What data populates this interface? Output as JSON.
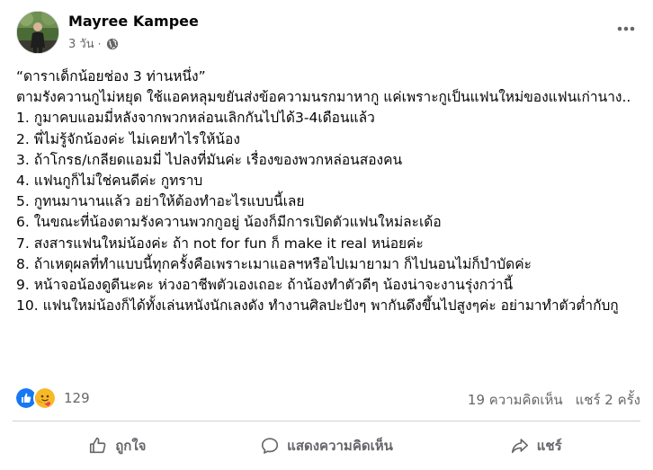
{
  "post": {
    "author": "Mayree Kampee",
    "time": "3 วัน",
    "separator": "·",
    "audience_icon": "globe-icon",
    "lines": [
      "“ดาราเด็กน้อยช่อง 3 ท่านหนึ่ง”",
      "ตามรังควานกูไม่หยุด ใช้แอคหลุมขยันส่งข้อความนรกมาหากู แค่เพราะกูเป็นแฟนใหม่ของแฟนเก่านาง..",
      "1. กูมาคบแอมมี่หลังจากพวกหล่อนเลิกกันไปได้3-4เดือนแล้ว",
      "2. พี่ไม่รู้จักน้องค่ะ ไม่เคยทำไรให้น้อง",
      "3. ถ้าโกรธ/เกลียดแอมมี่ ไปลงที่มันค่ะ เรื่องของพวกหล่อนสองคน",
      "4. แฟนกูก็ไม่ใช่คนดีค่ะ กูทราบ",
      "5. กูทนมานานแล้ว อย่าให้ต้องทำอะไรแบบนี้เลย",
      "6. ในขณะที่น้องตามรังควานพวกกูอยู่ น้องก็มีการเปิดตัวแฟนใหม่ละเด้อ",
      "7. สงสารแฟนใหม่น้องค่ะ ถ้า not for fun ก็ make it real หน่อยค่ะ",
      "8. ถ้าเหตุผลที่ทำแบบนี้ทุกครั้งคือเพราะเมาแอลฯหรือไปเมายามา ก็ไปนอนไม่ก็บำบัดค่ะ",
      "9. หน้าจอน้องดูดีนะคะ ห่วงอาชีพตัวเองเถอะ ถ้าน้องทำตัวดีๆ น้องน่าจะงานรุ่งกว่านี้",
      "10. แฟนใหม่น้องก็ได้ทั้งเล่นหนังนักเลงดัง ทำงานศิลปะปังๆ พากันดึงขึ้นไปสูงๆค่ะ อย่ามาทำตัวต่ำกับกู"
    ]
  },
  "reactions": {
    "icons": [
      "like-icon",
      "care-icon"
    ],
    "count": "129",
    "comments": "19 ความคิดเห็น",
    "shares": "แชร์ 2 ครั้ง"
  },
  "actions": {
    "like": "ถูกใจ",
    "comment": "แสดงความคิดเห็น",
    "share": "แชร์"
  },
  "colors": {
    "text": "#050505",
    "secondary": "#65676b",
    "like_blue": "#1877f2",
    "care_yellow": "#f7b928",
    "divider": "#ced0d4"
  }
}
